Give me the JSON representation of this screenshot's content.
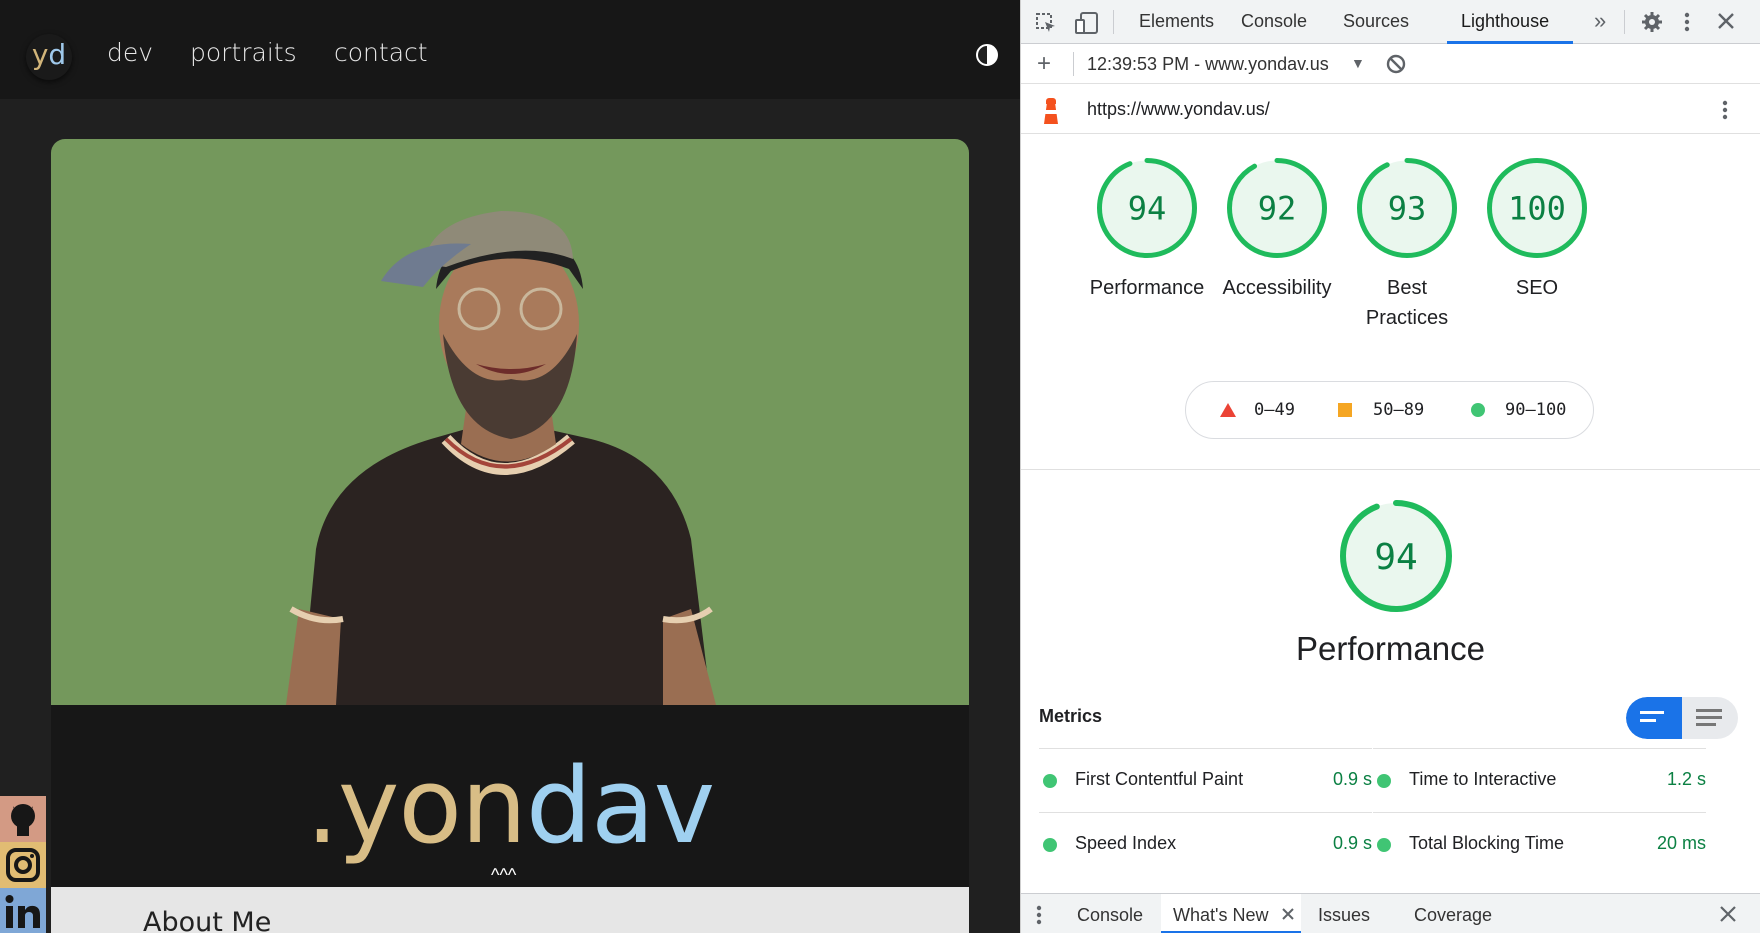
{
  "site": {
    "logo": {
      "y": "y",
      "d": "d"
    },
    "nav": [
      "dev",
      "portraits",
      "contact"
    ],
    "brand": {
      "part1": ".yon",
      "part2": "dav"
    },
    "scroll_hint": "^^^",
    "about_title": "About Me",
    "colors": {
      "header": "#171717",
      "card_bg": "#74985c",
      "brand_gold": "#d8bd86",
      "brand_blue": "#9fd0f0"
    }
  },
  "devtools": {
    "tabs": [
      "Elements",
      "Console",
      "Sources",
      "Lighthouse"
    ],
    "active_tab": "Lighthouse",
    "more_tabs_icon": "chevron-double-right-icon",
    "report_selector": "12:39:53 PM - www.yondav.us",
    "url": "https://www.yondav.us/",
    "scores": [
      {
        "label": "Performance",
        "value": 94
      },
      {
        "label": "Accessibility",
        "value": 92
      },
      {
        "label": "Best Practices",
        "value": 93
      },
      {
        "label": "SEO",
        "value": 100
      }
    ],
    "legend": {
      "fail": "0–49",
      "average": "50–89",
      "pass": "90–100"
    },
    "performance": {
      "score": 94,
      "title": "Performance"
    },
    "metrics_heading": "Metrics",
    "metrics": [
      {
        "name": "First Contentful Paint",
        "value": "0.9 s"
      },
      {
        "name": "Time to Interactive",
        "value": "1.2 s"
      },
      {
        "name": "Speed Index",
        "value": "0.9 s"
      },
      {
        "name": "Total Blocking Time",
        "value": "20 ms"
      }
    ],
    "drawer_tabs": [
      "Console",
      "What's New",
      "Issues",
      "Coverage"
    ],
    "drawer_active": "What's New",
    "colors": {
      "pass": "#1fbb5c",
      "average": "#f5a623",
      "fail": "#eb4335",
      "accent": "#1a73e8"
    }
  }
}
